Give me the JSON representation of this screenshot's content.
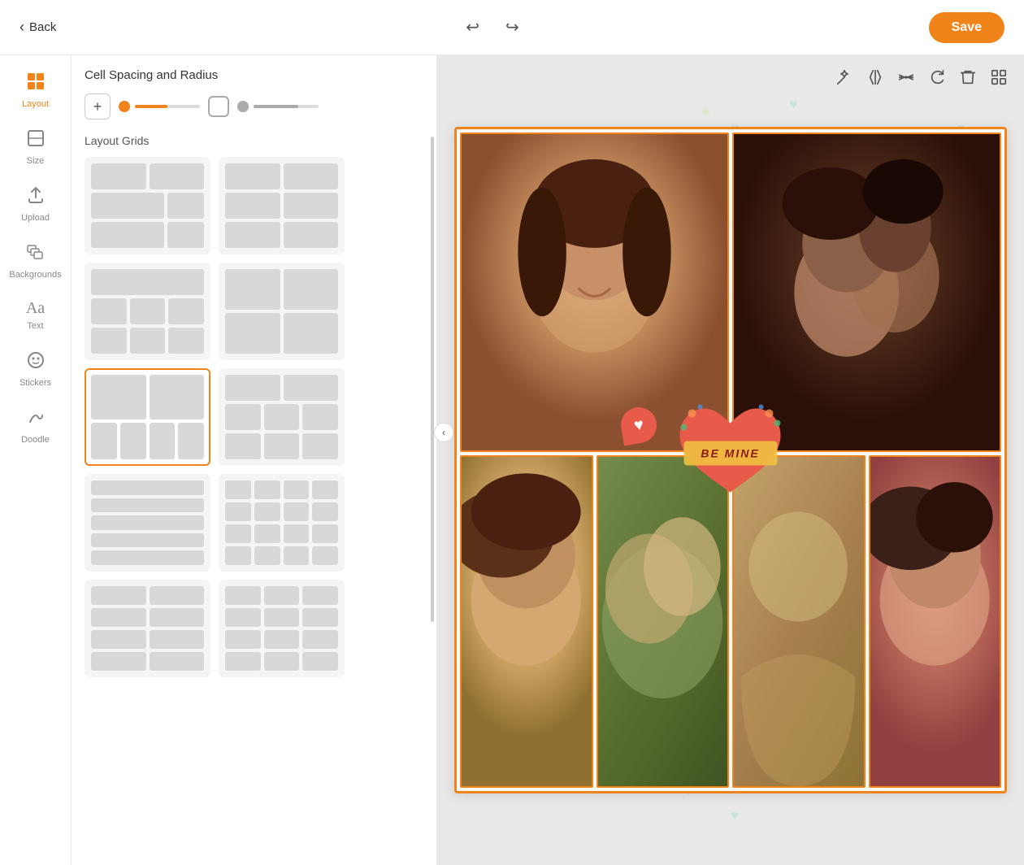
{
  "topbar": {
    "back_label": "Back",
    "save_label": "Save",
    "undo_icon": "↩",
    "redo_icon": "↪"
  },
  "sidebar": {
    "items": [
      {
        "id": "layout",
        "label": "Layout",
        "icon": "⊞",
        "active": true
      },
      {
        "id": "size",
        "label": "Size",
        "icon": "▭"
      },
      {
        "id": "upload",
        "label": "Upload",
        "icon": "⬆"
      },
      {
        "id": "backgrounds",
        "label": "Backgrounds",
        "icon": "🖼"
      },
      {
        "id": "text",
        "label": "Text",
        "icon": "Aa"
      },
      {
        "id": "stickers",
        "label": "Stickers",
        "icon": "☺"
      },
      {
        "id": "doodle",
        "label": "Doodle",
        "icon": "✍"
      }
    ]
  },
  "panel": {
    "title": "Cell Spacing and Radius",
    "section_title": "Layout Grids",
    "spacing": {
      "add_btn": "+",
      "orange_value": 40,
      "gray_value": 55
    }
  },
  "canvas_toolbar": {
    "tools": [
      {
        "id": "magic",
        "icon": "✨"
      },
      {
        "id": "flip-h",
        "icon": "▷◁"
      },
      {
        "id": "flip-v",
        "icon": "△▽"
      },
      {
        "id": "rotate",
        "icon": "↻"
      },
      {
        "id": "delete",
        "icon": "🗑"
      },
      {
        "id": "more",
        "icon": "⊞"
      }
    ]
  },
  "grids": [
    {
      "id": 0,
      "rows": [
        [
          1,
          1
        ],
        [
          2,
          1
        ],
        [
          2,
          1
        ]
      ]
    },
    {
      "id": 1,
      "rows": [
        [
          1,
          1
        ],
        [
          1,
          1
        ],
        [
          1,
          1
        ]
      ]
    },
    {
      "id": 2,
      "rows": [
        [
          1
        ],
        [
          2
        ],
        [
          2
        ]
      ]
    },
    {
      "id": 3,
      "rows": [
        [
          1,
          1
        ],
        [
          1,
          1
        ]
      ]
    },
    {
      "id": 4,
      "rows": [
        [
          1,
          1,
          1
        ],
        [
          1,
          1,
          1
        ],
        [
          1,
          1,
          1
        ]
      ],
      "selected": true
    },
    {
      "id": 5,
      "rows": [
        [
          1,
          1
        ],
        [
          1,
          1
        ]
      ]
    },
    {
      "id": 6,
      "rows": [
        [
          1
        ],
        [
          1
        ],
        [
          1
        ],
        [
          1
        ]
      ]
    },
    {
      "id": 7,
      "rows": [
        [
          1,
          1
        ],
        [
          1,
          1
        ],
        [
          1,
          1
        ],
        [
          1,
          1
        ]
      ]
    },
    {
      "id": 8,
      "rows": [
        [
          1,
          1
        ],
        [
          1,
          1
        ],
        [
          1,
          1
        ]
      ]
    },
    {
      "id": 9,
      "rows": [
        [
          1,
          1
        ],
        [
          1,
          1
        ],
        [
          1,
          1
        ],
        [
          1,
          1
        ]
      ]
    }
  ],
  "stickers": {
    "heart_badge": "♥",
    "be_mine_text": "BE MINE"
  }
}
